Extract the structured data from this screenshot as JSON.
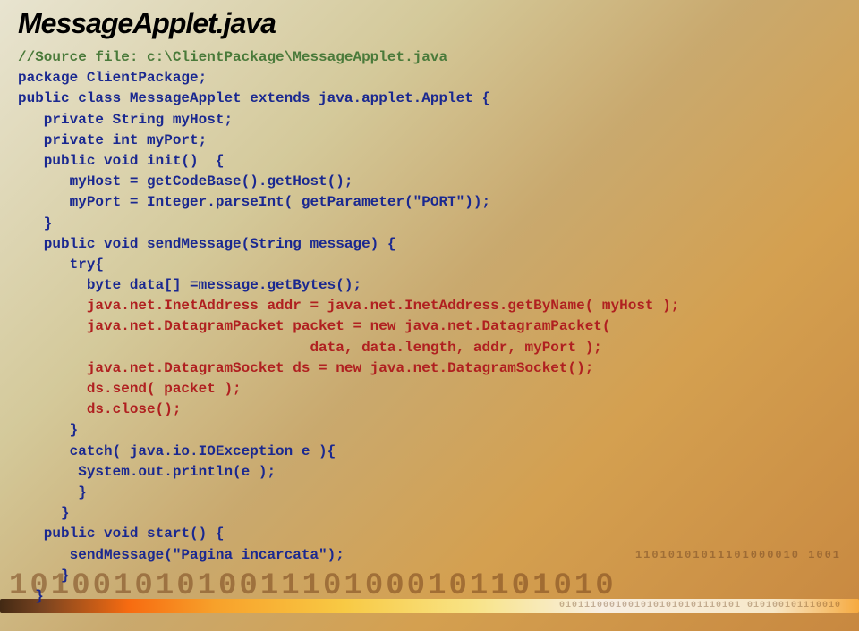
{
  "title": "MessageApplet.java",
  "code": {
    "l1": "//Source file: c:\\ClientPackage\\MessageApplet.java",
    "l2": "package ClientPackage;",
    "l3": "public class MessageApplet extends java.applet.Applet {",
    "l4": "   private String myHost;",
    "l5": "   private int myPort;",
    "l6": "   public void init()  {",
    "l7": "      myHost = getCodeBase().getHost();",
    "l8": "      myPort = Integer.parseInt( getParameter(\"PORT\"));",
    "l9": "   }",
    "l10": "   public void sendMessage(String message) {",
    "l11": "      try{",
    "l12": "        byte data[] =message.getBytes();",
    "l13": "        java.net.InetAddress addr = java.net.InetAddress.getByName( myHost );",
    "l14": "        java.net.DatagramPacket packet = new java.net.DatagramPacket(",
    "l15": "                                  data, data.length, addr, myPort );",
    "l16": "        java.net.DatagramSocket ds = new java.net.DatagramSocket();",
    "l17": "        ds.send( packet );",
    "l18": "        ds.close();",
    "l19": "      }",
    "l20": "      catch( java.io.IOException e ){",
    "l21": "       System.out.println(e );",
    "l22": "       }",
    "l23": "     }",
    "l24": "   public void start() {",
    "l25": "      sendMessage(\"Pagina incarcata\");",
    "l26": "     }",
    "l27": "  }"
  },
  "decor": {
    "binaryLarge": "10100101010011101000101101010",
    "binarySmall": "11010101011101000010  1001",
    "spectrumText": "01011100010010101010101110101 010100101110010"
  }
}
